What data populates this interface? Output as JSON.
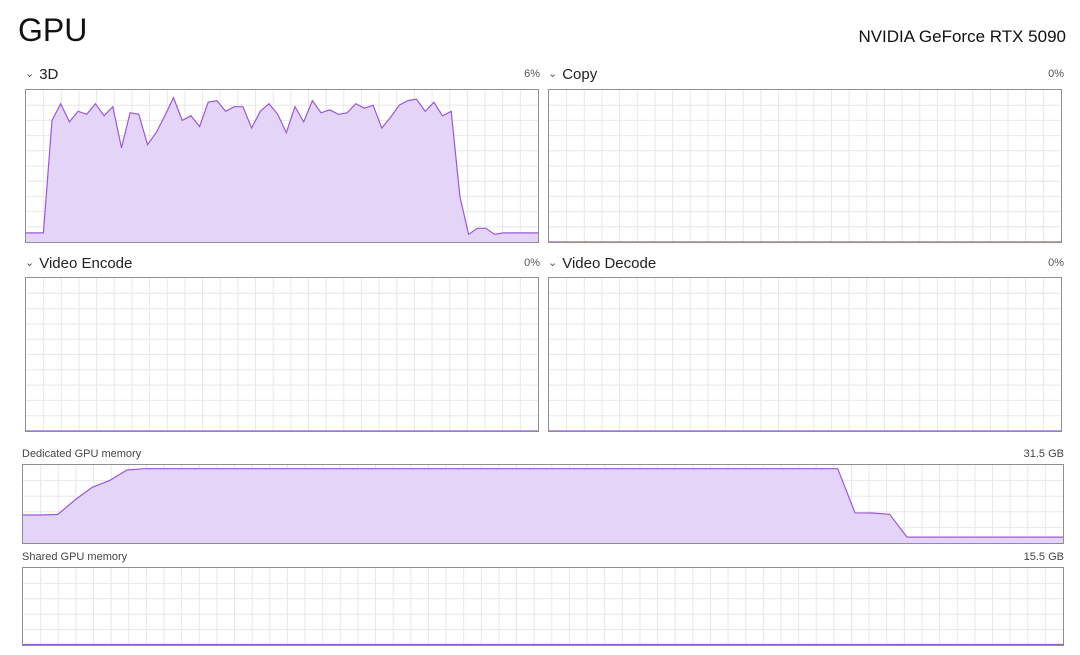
{
  "header": {
    "title": "GPU",
    "device": "NVIDIA GeForce RTX 5090"
  },
  "engines": [
    {
      "label": "3D",
      "value": "6%"
    },
    {
      "label": "Copy",
      "value": "0%"
    },
    {
      "label": "Video Encode",
      "value": "0%"
    },
    {
      "label": "Video Decode",
      "value": "0%"
    }
  ],
  "memory": {
    "dedicated": {
      "label": "Dedicated GPU memory",
      "value": "31.5 GB"
    },
    "shared": {
      "label": "Shared GPU memory",
      "value": "15.5 GB"
    }
  },
  "colors": {
    "line": "#9b59d6",
    "fill": "#e4d4f7",
    "grid": "#e8e8e8",
    "border": "#8f8f8f"
  },
  "chart_data": [
    {
      "type": "area",
      "name": "3D",
      "ylim": [
        0,
        100
      ],
      "values": [
        6,
        6,
        6,
        80,
        91,
        79,
        86,
        84,
        91,
        83,
        89,
        62,
        85,
        84,
        64,
        72,
        83,
        95,
        80,
        83,
        76,
        92,
        93,
        86,
        89,
        89,
        75,
        86,
        91,
        84,
        72,
        89,
        79,
        93,
        85,
        87,
        84,
        85,
        91,
        88,
        90,
        75,
        82,
        90,
        93,
        94,
        86,
        92,
        83,
        86,
        30,
        5,
        9,
        9,
        5,
        6,
        6,
        6,
        6,
        6
      ]
    },
    {
      "type": "area",
      "name": "Copy",
      "ylim": [
        0,
        100
      ],
      "values": [
        0,
        0,
        0,
        0,
        0,
        0,
        0,
        0,
        0,
        0
      ]
    },
    {
      "type": "area",
      "name": "Video Encode",
      "ylim": [
        0,
        100
      ],
      "values": [
        0,
        0,
        0,
        0,
        0,
        0,
        0,
        0,
        0,
        0
      ]
    },
    {
      "type": "area",
      "name": "Video Decode",
      "ylim": [
        0,
        100
      ],
      "values": [
        0,
        0,
        0,
        0,
        0,
        0,
        0,
        0,
        0,
        0
      ]
    },
    {
      "type": "area",
      "name": "Dedicated GPU memory",
      "ylim": [
        0,
        31.5
      ],
      "values": [
        11.3,
        11.3,
        11.5,
        17.4,
        22.5,
        25.3,
        29.5,
        30.0,
        30.0,
        30.0,
        30.0,
        30.0,
        30.0,
        30.0,
        30.0,
        30.0,
        30.0,
        30.0,
        30.0,
        30.0,
        30.0,
        30.0,
        30.0,
        30.0,
        30.0,
        30.0,
        30.0,
        30.0,
        30.0,
        30.0,
        30.0,
        30.0,
        30.0,
        30.0,
        30.0,
        30.0,
        30.0,
        30.0,
        30.0,
        30.0,
        30.0,
        30.0,
        30.0,
        30.0,
        30.0,
        30.0,
        30.0,
        30.0,
        12.2,
        12.1,
        11.6,
        2.4,
        2.4,
        2.4,
        2.4,
        2.4,
        2.4,
        2.4,
        2.4,
        2.4,
        2.4
      ]
    },
    {
      "type": "area",
      "name": "Shared GPU memory",
      "ylim": [
        0,
        15.5
      ],
      "values": [
        0.1,
        0.1,
        0.1,
        0.1,
        0.1,
        0.1,
        0.1,
        0.1,
        0.1,
        0.1
      ]
    }
  ]
}
